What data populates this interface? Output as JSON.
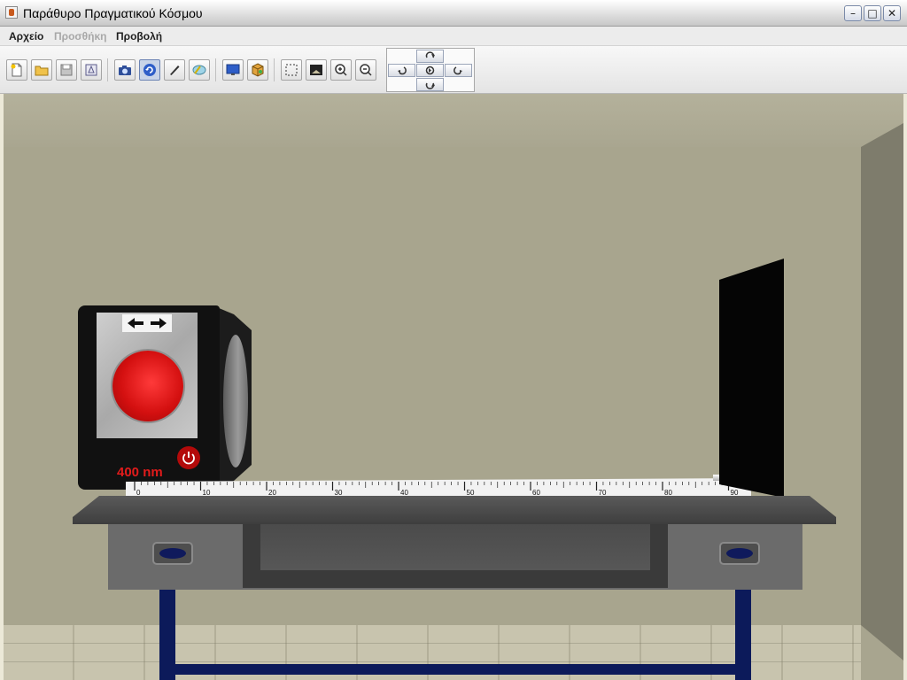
{
  "window": {
    "title": "Παράθυρο Πραγματικού Κόσμου",
    "controls": {
      "minimize": "–",
      "maximize": "□",
      "close": "✕"
    }
  },
  "menu": {
    "items": [
      {
        "label": "Αρχείο",
        "enabled": true
      },
      {
        "label": "Προσθήκη",
        "enabled": false
      },
      {
        "label": "Προβολή",
        "enabled": true
      }
    ]
  },
  "toolbar": {
    "buttons": [
      {
        "icon": "new-file-icon"
      },
      {
        "icon": "open-folder-icon"
      },
      {
        "icon": "save-icon"
      },
      {
        "icon": "print-icon"
      },
      {
        "icon": "camera-icon"
      },
      {
        "icon": "rotate-object-icon",
        "active": true
      },
      {
        "icon": "pencil-icon"
      },
      {
        "icon": "eraser-icon"
      },
      {
        "icon": "monitor-icon"
      },
      {
        "icon": "objects-cube-icon"
      },
      {
        "icon": "fit-view-icon"
      },
      {
        "icon": "reset-view-icon"
      },
      {
        "icon": "zoom-in-icon"
      },
      {
        "icon": "zoom-out-icon"
      }
    ],
    "navigation": [
      "rotate-up-icon",
      "rotate-left-icon",
      "rotate-center-icon",
      "rotate-right-icon",
      "rotate-down-icon"
    ]
  },
  "scene": {
    "light_source": {
      "wavelength": "400 nm",
      "color": "#e21b1b"
    },
    "ruler": {
      "labels": [
        "0",
        "10",
        "20",
        "30",
        "40",
        "50",
        "60",
        "70",
        "80",
        "90"
      ]
    }
  }
}
